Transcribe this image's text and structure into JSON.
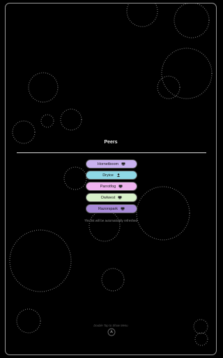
{
  "screen": {
    "title": "Peers",
    "note": "The list will be automatically refreshed",
    "hint": "Double Tap to Show Menu"
  },
  "peers": [
    {
      "label": "Hornetboom",
      "icon": "desktop-icon",
      "color": "#c9b1f0"
    },
    {
      "label": "Dryice",
      "icon": "person-icon",
      "color": "#8fd8e6"
    },
    {
      "label": "Parrotfog",
      "icon": "desktop-icon",
      "color": "#efb2ef"
    },
    {
      "label": "Owlwest",
      "icon": "desktop-icon",
      "color": "#d7f0c9"
    },
    {
      "label": "Razorspark",
      "icon": "desktop-icon",
      "color": "#a88ad8"
    }
  ],
  "colors": {
    "background": "#000000",
    "frame": "#9a9a9a",
    "bubbles": "#6e6e6e"
  }
}
